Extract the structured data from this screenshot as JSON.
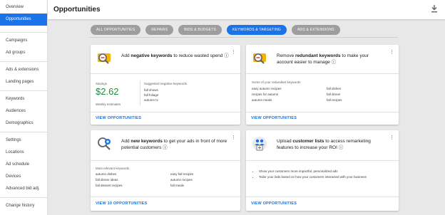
{
  "sidebar": {
    "items": [
      {
        "label": "Overview",
        "active": false
      },
      {
        "label": "Opportunities",
        "active": true
      },
      {
        "label": "Campaigns"
      },
      {
        "label": "Ad groups"
      },
      {
        "label": "Ads & extensions"
      },
      {
        "label": "Landing pages"
      },
      {
        "label": "Keywords"
      },
      {
        "label": "Audiences"
      },
      {
        "label": "Demographics"
      },
      {
        "label": "Settings"
      },
      {
        "label": "Locations"
      },
      {
        "label": "Ad schedule"
      },
      {
        "label": "Devices"
      },
      {
        "label": "Advanced bid adj."
      },
      {
        "label": "Change history"
      }
    ]
  },
  "header": {
    "title": "Opportunities"
  },
  "filters": [
    "ALL OPPORTUNITIES",
    "REPAIRS",
    "BIDS & BUDGETS",
    "KEYWORDS & TARGETING",
    "ADS & EXTENSIONS"
  ],
  "colors": {
    "accent": "#1a73e8",
    "savings": "#1e8e3e",
    "chip_inactive": "#9e9e9e"
  },
  "cards": {
    "negative": {
      "title_pre": "Add ",
      "title_bold": "negative keywords",
      "title_post": " to reduce wasted spend ⓘ",
      "savings_label": "Savings",
      "savings_value": "$2.62",
      "savings_sub": "Weekly estimates",
      "list_label": "Suggested negative keywords",
      "items": [
        "fall shows",
        "fall foliage",
        "autumn tv"
      ],
      "link": "VIEW OPPORTUNITIES"
    },
    "redundant": {
      "title_pre": "Remove ",
      "title_bold": "redundant keywords",
      "title_post": " to make your account easier to manage ⓘ",
      "list_label": "Some of your redundant keywords",
      "col1": [
        "easy autumn recipes",
        "recipes for autumn",
        "autumn meals"
      ],
      "col2": [
        "fall dishes",
        "fall dinner",
        "fall recipes"
      ],
      "link": "VIEW OPPORTUNITIES"
    },
    "new_keywords": {
      "title_pre": "Add ",
      "title_bold": "new keywords",
      "title_post": " to get your ads in front of more potential customers ⓘ",
      "list_label": "Most relevant keywords",
      "col1": [
        "autumn dishes",
        "fall dinner ideas",
        "fall dessert recipes"
      ],
      "col2": [
        "easy fall recipes",
        "autumn recipes",
        "fall meals"
      ],
      "link": "VIEW 10 OPPORTUNITIES"
    },
    "customer_lists": {
      "title_pre": "Upload ",
      "title_bold": "customer lists",
      "title_post": " to access remarketing features to increase your ROI ⓘ",
      "bullets": [
        "Show your customers more impactful, personalized ads",
        "Tailor your bids based on how your customers interacted with your business"
      ],
      "link": "VIEW OPPORTUNITIES"
    }
  }
}
